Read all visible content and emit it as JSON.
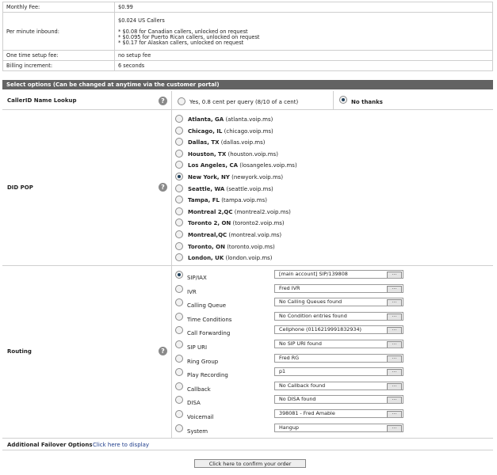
{
  "info": {
    "monthly_fee_label": "Monthly Fee:",
    "monthly_fee_value": "$0.99",
    "per_minute_label": "Per minute inbound:",
    "per_minute_value": "$0.024 US Callers",
    "per_minute_notes": [
      "* $0.08 for Canadian callers, unlocked on request",
      "* $0.095 for Puerto Rican callers, unlocked on request",
      "* $0.17 for Alaskan callers, unlocked on request"
    ],
    "setup_label": "One time setup fee:",
    "setup_value": "no setup fee",
    "billing_label": "Billing increment:",
    "billing_value": "6 seconds"
  },
  "section_header": "Select options (Can be changed at anytime via the customer portal)",
  "callerid": {
    "label": "CallerID Name Lookup",
    "option_yes": "Yes, 0.8 cent per query (8/10 of a cent)",
    "option_no": "No thanks",
    "selected": "no"
  },
  "did_pop": {
    "label": "DID POP",
    "options": [
      {
        "city": "Atlanta, GA",
        "host": "(atlanta.voip.ms)"
      },
      {
        "city": "Chicago, IL",
        "host": "(chicago.voip.ms)"
      },
      {
        "city": "Dallas, TX",
        "host": "(dallas.voip.ms)"
      },
      {
        "city": "Houston, TX",
        "host": "(houston.voip.ms)"
      },
      {
        "city": "Los Angeles, CA",
        "host": "(losangeles.voip.ms)"
      },
      {
        "city": "New York, NY",
        "host": "(newyork.voip.ms)"
      },
      {
        "city": "Seattle, WA",
        "host": "(seattle.voip.ms)"
      },
      {
        "city": "Tampa, FL",
        "host": "(tampa.voip.ms)"
      },
      {
        "city": "Montreal 2,QC",
        "host": "(montreal2.voip.ms)"
      },
      {
        "city": "Toronto 2, ON",
        "host": "(toronto2.voip.ms)"
      },
      {
        "city": "Montreal,QC",
        "host": "(montreal.voip.ms)"
      },
      {
        "city": "Toronto, ON",
        "host": "(toronto.voip.ms)"
      },
      {
        "city": "London, UK",
        "host": "(london.voip.ms)"
      }
    ],
    "selected_index": 5
  },
  "routing": {
    "label": "Routing",
    "options": [
      {
        "label": "SIP/IAX",
        "value": "[main account] SIP/139808"
      },
      {
        "label": "IVR",
        "value": "Fred IVR"
      },
      {
        "label": "Calling Queue",
        "value": "No Calling Queues found"
      },
      {
        "label": "Time Conditions",
        "value": "No Condition entries found"
      },
      {
        "label": "Call Forwarding",
        "value": "Cellphone (0116219991832934)"
      },
      {
        "label": "SIP URI",
        "value": "No SIP URI found"
      },
      {
        "label": "Ring Group",
        "value": "Fred RG"
      },
      {
        "label": "Play Recording",
        "value": "p1"
      },
      {
        "label": "Callback",
        "value": "No Callback found"
      },
      {
        "label": "DISA",
        "value": "No DISA found"
      },
      {
        "label": "Voicemail",
        "value": "398081 - Fred Amable"
      },
      {
        "label": "System",
        "value": "Hangup"
      }
    ],
    "selected_index": 0,
    "browse_label": "..."
  },
  "failover": {
    "label": "Additional Failover Options",
    "link": "Click here to display"
  },
  "confirm_button": "Click here to confirm your order"
}
